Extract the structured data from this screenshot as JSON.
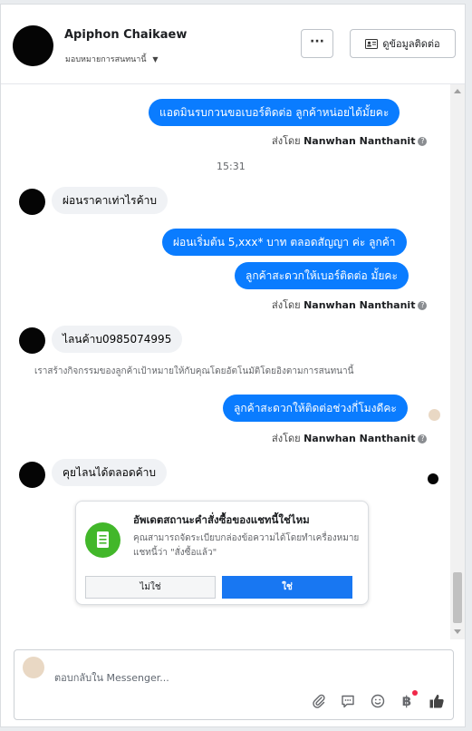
{
  "header": {
    "name": "Apiphon Chaikaew",
    "assign_label": "มอบหมายการสนทนานี้",
    "more_label": "···",
    "contact_label": "ดูข้อมูลติดต่อ"
  },
  "messages": {
    "out1": "แอดมินรบกวนขอเบอร์ติดต่อ ลูกค้าหน่อยได้มั้ยคะ",
    "sent_prefix": "ส่งโดย",
    "sender": "Nanwhan Nanthanit",
    "time": "15:31",
    "in1": "ผ่อนราคาเท่าไรค้าบ",
    "out2": "ผ่อนเริ่มต้น 5,xxx* บาท ตลอดสัญญา ค่ะ ลูกค้า",
    "out3": "ลูกค้าสะดวกให้เบอร์ติดต่อ มั้ยคะ",
    "in2": "ไลนค้าบ0985074995",
    "system_note": "เราสร้างกิจกรรมของลูกค้าเป้าหมายให้กับคุณโดยอัตโนมัติโดยอิงตามการสนทนานี้",
    "out4": "ลูกค้าสะดวกให้ติดต่อช่วงกี่โมงดีคะ",
    "in3": "คุยไลนได้ตลอดค้าบ"
  },
  "order_card": {
    "title": "อัพเดตสถานะคำสั่งซื้อของแชทนี้ใช่ไหม",
    "description": "คุณสามารถจัดระเบียบกล่องข้อความได้โดยทำเครื่องหมายแชทนี้ว่า \"สั่งซื้อแล้ว\"",
    "no_label": "ไม่ใช่",
    "yes_label": "ใช่"
  },
  "composer": {
    "placeholder": "ตอบกลับใน Messenger..."
  },
  "colors": {
    "accent": "#0a7cff",
    "button_blue": "#1877f2",
    "card_icon_green": "#42b72a"
  },
  "icons": [
    "more-icon",
    "contact-card-icon",
    "caret-down-icon",
    "help-icon",
    "scroll-up-icon",
    "scroll-down-icon",
    "order-list-icon",
    "attachment-icon",
    "saved-reply-icon",
    "emoji-icon",
    "baht-icon",
    "like-icon"
  ]
}
